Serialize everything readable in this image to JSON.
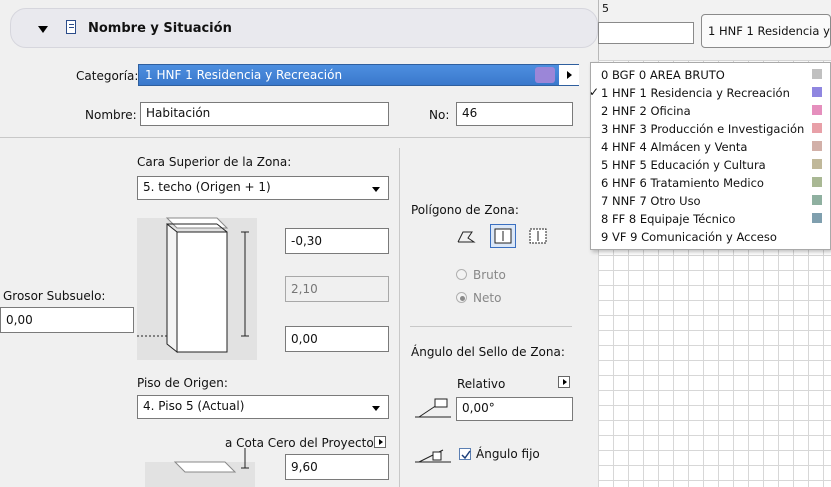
{
  "header": {
    "title": "Nombre y Situación"
  },
  "category": {
    "label": "Categoría:",
    "value": "1 HNF  1 Residencia y Recreación",
    "swatch": "#9b86d8"
  },
  "name": {
    "label": "Nombre:",
    "value": "Habitación"
  },
  "number": {
    "label": "No:",
    "value": "46"
  },
  "top": {
    "label": "Cara Superior de la Zona:",
    "value": "5. techo (Origen + 1)"
  },
  "offsets": {
    "top_value": "-0,30",
    "height_value": "2,10",
    "bottom_value": "0,00"
  },
  "subfloor": {
    "label": "Grosor Subsuelo:",
    "value": "0,00"
  },
  "home_floor": {
    "label": "Piso de Origen:",
    "value": "4. Piso 5 (Actual)"
  },
  "project_zero": {
    "label": "a Cota Cero del Proyecto",
    "value": "9,60"
  },
  "polygon": {
    "label": "Polígono de Zona:",
    "bruto": "Bruto",
    "neto": "Neto"
  },
  "stamp": {
    "label": "Ángulo del Sello de Zona:",
    "relative_label": "Relativo",
    "angle_value": "0,00°",
    "fixed_label": "Ángulo fijo"
  },
  "background_window": {
    "cell_top": "5",
    "combo_value": "1 HNF  1 Residencia y"
  },
  "menu": {
    "items": [
      {
        "label": "0 BGF 0 AREA BRUTO",
        "color": "#c0c0c0",
        "checked": false
      },
      {
        "label": "1 HNF 1 Residencia y Recreación",
        "color": "#8f86e0",
        "checked": true
      },
      {
        "label": "2 HNF 2 Oficina",
        "color": "#e58fbd",
        "checked": false
      },
      {
        "label": "3 HNF 3 Producción e Investigación",
        "color": "#e8a0a8",
        "checked": false
      },
      {
        "label": "4 HNF 4 Almácen y Venta",
        "color": "#d2b0a8",
        "checked": false
      },
      {
        "label": "5 HNF 5 Educación y Cultura",
        "color": "#c0b89a",
        "checked": false
      },
      {
        "label": "6 HNF 6 Tratamiento Medico",
        "color": "#a9b894",
        "checked": false
      },
      {
        "label": "7 NNF 7 Otro Uso",
        "color": "#8fb0a0",
        "checked": false
      },
      {
        "label": "8 FF  8 Equipaje Técnico",
        "color": "#7f9fae",
        "checked": false
      },
      {
        "label": "9 VF  9 Comunicación y Acceso",
        "color": "#c0c0c0",
        "checked": false
      }
    ]
  }
}
